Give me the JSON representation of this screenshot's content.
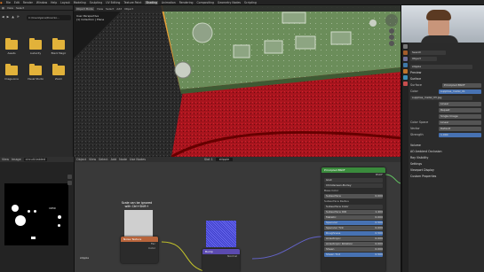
{
  "topbar": {
    "menus": [
      "File",
      "Edit",
      "Render",
      "Window",
      "Help"
    ],
    "tabs": [
      "Layout",
      "Modeling",
      "Sculpting",
      "UV Editing",
      "Texture Paint",
      "Shading",
      "Animation",
      "Rendering",
      "Compositing",
      "Geometry Nodes",
      "Scripting"
    ],
    "active_tab": "Shading",
    "scene": "Scene",
    "view_layer": "ViewLayer"
  },
  "filebrowser": {
    "header": [
      "View",
      "Select"
    ],
    "path": "C:\\Users\\Jana\\Downlo...",
    "folders": [
      "Assets",
      "Audacity",
      "Black Magic",
      "Image-Line",
      "Visual Studio",
      "Zoom"
    ]
  },
  "viewport": {
    "header": [
      "Object Mode",
      "View",
      "Select",
      "Add",
      "Object"
    ],
    "overlay_line1": "User Perspective",
    "overlay_line2": "(1) Collection | Plane"
  },
  "image_editor": {
    "header": [
      "View",
      "Image"
    ],
    "image_name": "circuit.tabled",
    "texture_text": "1650"
  },
  "node_editor": {
    "header": [
      "Object",
      "View",
      "Select",
      "Add",
      "Node",
      "Use Nodes"
    ],
    "slot": "Slot 1",
    "material": "stipple",
    "annotation": "Scale can be ignored with Ctrl+Shift+",
    "noise_node": "Noise Texture",
    "noise_sockets": [
      "Fac",
      "Color"
    ],
    "bump_node": "Bump",
    "bump_socket": "Normal",
    "frame_label": "stipple",
    "principled": {
      "title": "Principled BSDF",
      "output": "BSDF",
      "dist": "GGX",
      "ss_method": "Christensen-Burley",
      "base_color": "Base Color",
      "fields": [
        {
          "label": "Subsurface",
          "value": "0.000"
        },
        {
          "label": "Subsurface Radius",
          "value": ""
        },
        {
          "label": "Subsurface Color",
          "value": ""
        },
        {
          "label": "Subsurface IOR",
          "value": "1.400"
        },
        {
          "label": "Metallic",
          "value": "0.000"
        },
        {
          "label": "Specular",
          "value": "0.500"
        },
        {
          "label": "Specular Tint",
          "value": "0.000"
        },
        {
          "label": "Roughness",
          "value": "0.500"
        },
        {
          "label": "Anisotropic",
          "value": "0.000"
        },
        {
          "label": "Anisotropic Rotation",
          "value": "0.000"
        },
        {
          "label": "Sheen",
          "value": "0.000"
        },
        {
          "label": "Sheen Tint",
          "value": "0.500"
        }
      ]
    }
  },
  "properties": {
    "search": "Search",
    "tab": "Object",
    "material": "stipple",
    "sections": [
      "Preview",
      "Surface"
    ],
    "surface": "Surface",
    "surface_value": "Principled BSDF",
    "color_label": "Color",
    "color_value": "supplies_metal_01",
    "image_name": "supplies_metal_03.jpg",
    "settings": [
      "Linear",
      "Repeat",
      "Single Image"
    ],
    "color_space_label": "Color Space",
    "color_space": "Linear",
    "vector_label": "Vector",
    "vector_value": "Default",
    "strength_label": "Strength",
    "strength_value": "1.000",
    "bottom_sections": [
      "Volume",
      "Displacement",
      "Settings",
      "Line Art",
      "Viewport Display",
      "Custom Properties"
    ],
    "viewport_items": [
      "Volume",
      "AO Ambient Occlusion",
      "Ray Visibility",
      "Settings",
      "Viewport Display",
      "Custom Properties"
    ]
  },
  "colors": {
    "accent_orange": "#e8791f",
    "node_green": "#3f9a3a",
    "node_bsdf_green": "#3a8a3c",
    "blue_field": "#4772b3",
    "red_cylinder": "#b3121c"
  }
}
